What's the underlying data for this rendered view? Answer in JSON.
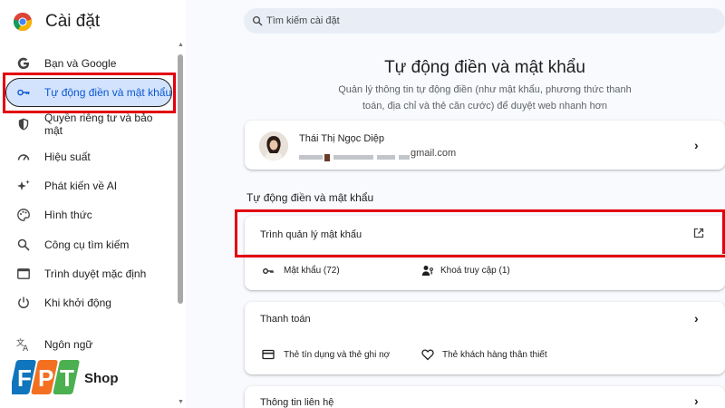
{
  "app": {
    "title": "Cài đặt",
    "icon": "chrome-logo-icon"
  },
  "sidebar": {
    "items": [
      {
        "label": "Bạn và Google",
        "icon": "google-g-icon"
      },
      {
        "label": "Tự động điền và mật khẩu",
        "icon": "key-icon",
        "active": true
      },
      {
        "label": "Quyền riêng tư và bảo mật",
        "icon": "shield-icon"
      },
      {
        "label": "Hiệu suất",
        "icon": "speedometer-icon"
      },
      {
        "label": "Phát kiến về AI",
        "icon": "sparkle-icon"
      },
      {
        "label": "Hình thức",
        "icon": "palette-icon"
      },
      {
        "label": "Công cụ tìm kiếm",
        "icon": "search-icon"
      },
      {
        "label": "Trình duyệt mặc định",
        "icon": "browser-window-icon"
      },
      {
        "label": "Khi khởi động",
        "icon": "power-icon"
      },
      {
        "label": "Ngôn ngữ",
        "icon": "translate-icon"
      }
    ]
  },
  "brand": {
    "text": "FPT Shop",
    "letters": [
      "F",
      "P",
      "T"
    ],
    "word": "Shop"
  },
  "search": {
    "placeholder": "Tìm kiếm cài đặt"
  },
  "main": {
    "title": "Tự động điền và mật khẩu",
    "description": "Quản lý thông tin tự động điền (như mật khẩu, phương thức thanh toán, địa chỉ và thẻ căn cước) để duyệt web nhanh hơn",
    "account": {
      "name": "Thái Thị Ngọc Diệp",
      "email_visible": "gmail.com"
    },
    "section_heading": "Tự động điền và mật khẩu",
    "password_manager": {
      "label": "Trình quản lý mật khẩu",
      "passwords": "Mật khẩu (72)",
      "passkeys": "Khoá truy cập (1)"
    },
    "payment": {
      "label": "Thanh toán",
      "cards": "Thẻ tín dụng và thẻ ghi nợ",
      "loyalty": "Thẻ khách hàng thân thiết"
    },
    "contact": {
      "label": "Thông tin liên hệ"
    }
  },
  "colors": {
    "highlight": "#e3000f",
    "active_bg": "#d3e3fd",
    "active_text": "#0b57d0",
    "fpt_blue": "#0f75bc",
    "fpt_orange": "#f37021",
    "fpt_green": "#4caf50"
  }
}
